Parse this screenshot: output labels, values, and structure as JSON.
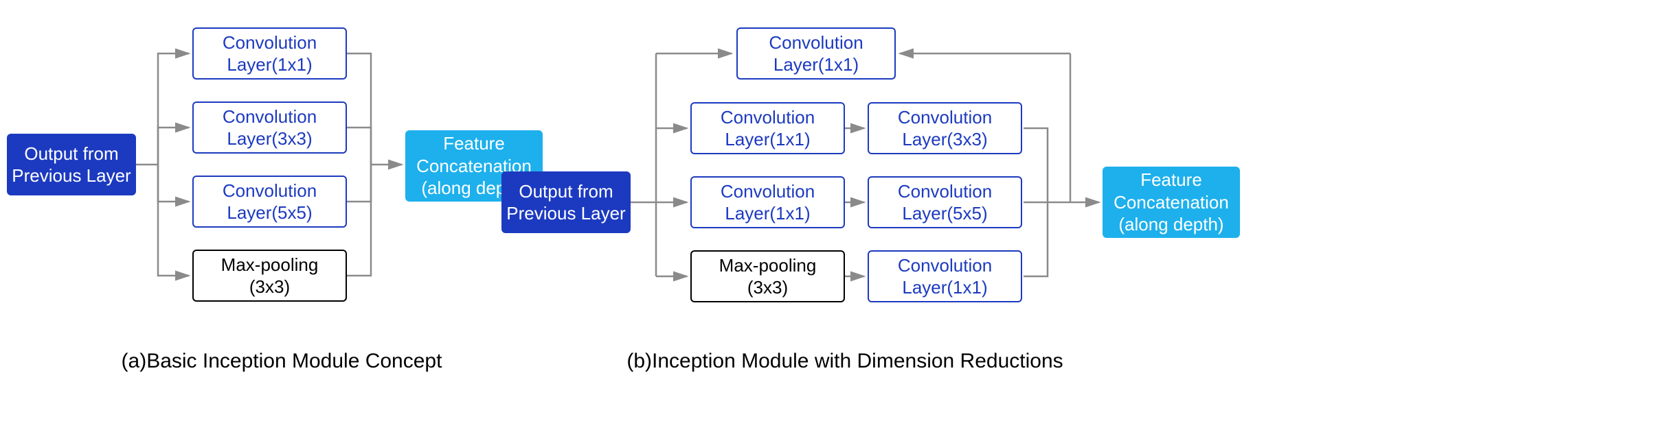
{
  "colors": {
    "dark_blue": "#1c3ac0",
    "light_blue": "#1db0ec",
    "black": "#000000",
    "arrow": "#8a8a8a"
  },
  "diagram_a": {
    "caption": "(a)Basic Inception Module Concept",
    "input": {
      "line1": "Output from",
      "line2": "Previous Layer"
    },
    "branches": [
      {
        "line1": "Convolution",
        "line2": "Layer(1x1)",
        "style": "outlined-blue"
      },
      {
        "line1": "Convolution",
        "line2": "Layer(3x3)",
        "style": "outlined-blue"
      },
      {
        "line1": "Convolution",
        "line2": "Layer(5x5)",
        "style": "outlined-blue"
      },
      {
        "line1": "Max-pooling",
        "line2": "(3x3)",
        "style": "outlined-black"
      }
    ],
    "output": {
      "line1": "Feature",
      "line2": "Concatenation",
      "line3": "(along depth)"
    }
  },
  "diagram_b": {
    "caption": "(b)Inception Module with Dimension Reductions",
    "input": {
      "line1": "Output from",
      "line2": "Previous Layer"
    },
    "top_block": {
      "line1": "Convolution",
      "line2": "Layer(1x1)",
      "style": "outlined-blue"
    },
    "col1": [
      {
        "line1": "Convolution",
        "line2": "Layer(1x1)",
        "style": "outlined-blue"
      },
      {
        "line1": "Convolution",
        "line2": "Layer(1x1)",
        "style": "outlined-blue"
      },
      {
        "line1": "Max-pooling",
        "line2": "(3x3)",
        "style": "outlined-black"
      }
    ],
    "col2": [
      {
        "line1": "Convolution",
        "line2": "Layer(3x3)",
        "style": "outlined-blue"
      },
      {
        "line1": "Convolution",
        "line2": "Layer(5x5)",
        "style": "outlined-blue"
      },
      {
        "line1": "Convolution",
        "line2": "Layer(1x1)",
        "style": "outlined-blue"
      }
    ],
    "output": {
      "line1": "Feature",
      "line2": "Concatenation",
      "line3": "(along depth)"
    }
  }
}
